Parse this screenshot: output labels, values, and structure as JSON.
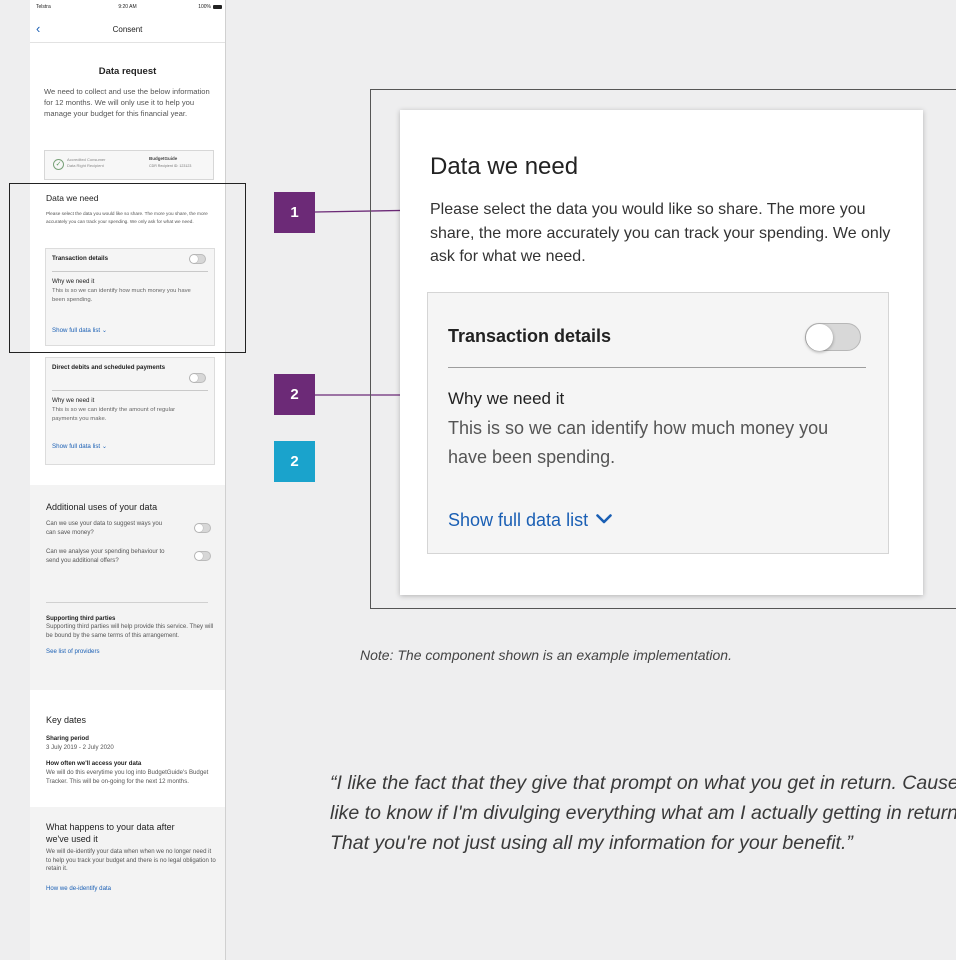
{
  "phone": {
    "status": {
      "carrier": "Telstra",
      "time": "9:20 AM",
      "battery": "100%"
    },
    "nav": {
      "back": "‹",
      "title": "Consent"
    },
    "data_request": {
      "title": "Data request",
      "body": "We need to collect and use the below information for 12 months. We will only use it to help you manage your budget for this financial year.",
      "accreditation": {
        "label": "Accredited Consumer Data Right Recipient",
        "brand": "BudgetGuide",
        "id": "CDR Recipient ID: 123123"
      }
    },
    "data_we_need": {
      "title": "Data we need",
      "body": "Please select the data you would like so share. The more you share, the more accurately you can track your spending. We only ask for what we need.",
      "cards": [
        {
          "title": "Transaction details",
          "why": "Why we need it",
          "why_body": "This is so we can identify how much money you have been spending.",
          "show": "Show full data list"
        },
        {
          "title": "Direct debits and scheduled payments",
          "why": "Why we need it",
          "why_body": "This is so we can identify the amount of regular payments you make.",
          "show": "Show full data list"
        }
      ]
    },
    "additional": {
      "title": "Additional uses of your data",
      "q1": "Can we use your data to suggest ways you can save money?",
      "q2": "Can we analyse your spending behaviour to send you additional offers?",
      "third_title": "Supporting third parties",
      "third_body": "Supporting third parties will help provide this service. They will be bound by the same terms of this arrangement.",
      "third_link": "See list of providers"
    },
    "key_dates": {
      "title": "Key dates",
      "period_label": "Sharing period",
      "period_value": "3 July 2019 - 2 July 2020",
      "access_label": "How often we'll access your data",
      "access_body": "We will do this everytime you log into BudgetGuide's Budget Tracker. This will be on-going for the next 12 months."
    },
    "after": {
      "title": "What happens to your data after we've used it",
      "body": "We will de-identify your data when when we no longer need it to help you track your budget and there is no legal obligation to retain it.",
      "link": "How we de-identify data"
    }
  },
  "badges": [
    "1",
    "2",
    "2"
  ],
  "component": {
    "title": "Data we need",
    "body": "Please select the data you would like so share. The more you share, the more accurately you can track your spending. We only ask for what we need.",
    "card_title": "Transaction details",
    "why": "Why we need it",
    "why_body": "This is so we can identify how much money you have been spending.",
    "show": "Show full data list"
  },
  "note": "Note: The component shown is an example implementation.",
  "quote": "“I like the fact that they give that prompt on what you get in return. Cause I like to know if I'm divulging everything what am I actually getting in return. That you're not just using all my information for your benefit.”",
  "colors": {
    "purple": "#6c2a77",
    "teal": "#1aa3cc",
    "link": "#1a5fb4"
  }
}
